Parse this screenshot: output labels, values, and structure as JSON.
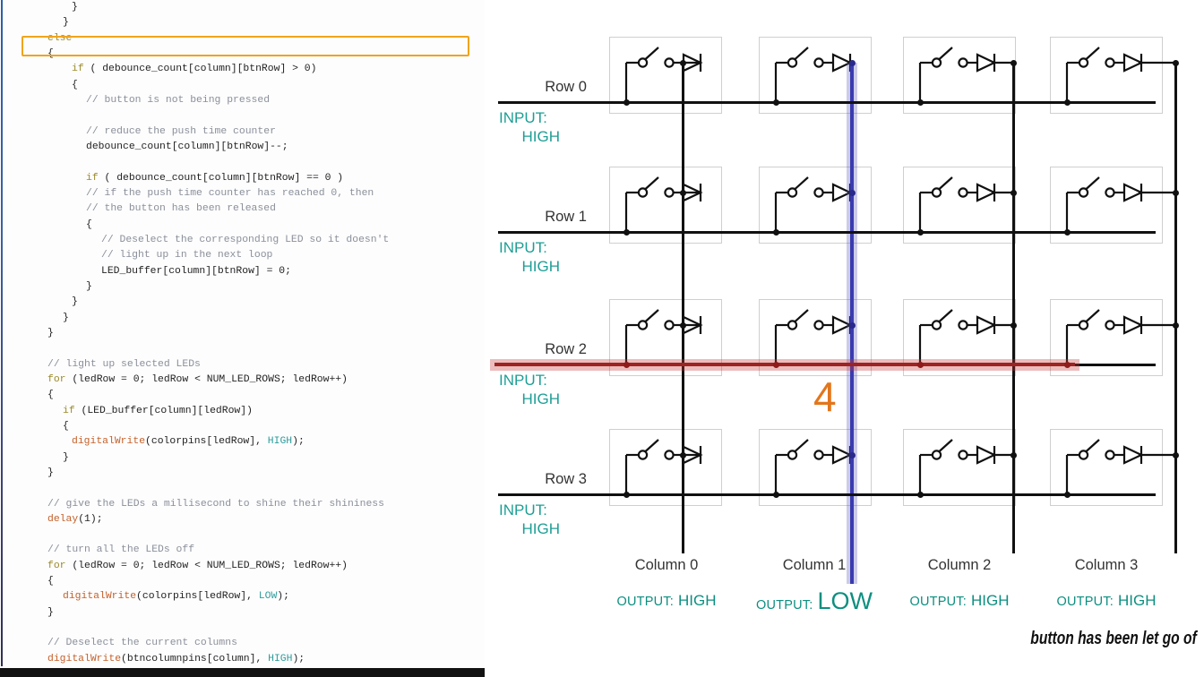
{
  "code_panel": {
    "highlighted_line": "else",
    "lines": [
      {
        "indent": "ind3",
        "text": "}"
      },
      {
        "indent": "ind2",
        "text": "}"
      },
      {
        "indent": "ind1",
        "text": "else"
      },
      {
        "indent": "ind1",
        "text": "{"
      },
      {
        "indent": "ind3",
        "text": "if ( debounce_count[column][btnRow] > 0)"
      },
      {
        "indent": "ind3",
        "text": "{"
      },
      {
        "indent": "ind4",
        "text": "// button is not being pressed"
      },
      {
        "indent": "ind4",
        "text": ""
      },
      {
        "indent": "ind4",
        "text": "// reduce the push time counter"
      },
      {
        "indent": "ind4",
        "text": "debounce_count[column][btnRow]--;"
      },
      {
        "indent": "ind4",
        "text": ""
      },
      {
        "indent": "ind4",
        "text": "if ( debounce_count[column][btnRow] == 0 )"
      },
      {
        "indent": "ind4",
        "text": "// if the push time counter has reached 0, then"
      },
      {
        "indent": "ind4",
        "text": "// the button has been released"
      },
      {
        "indent": "ind4",
        "text": "{"
      },
      {
        "indent": "ind5",
        "text": "// Deselect the corresponding LED so it doesn't"
      },
      {
        "indent": "ind5",
        "text": "// light up in the next loop"
      },
      {
        "indent": "ind5",
        "text": "LED_buffer[column][btnRow] = 0;"
      },
      {
        "indent": "ind4",
        "text": "}"
      },
      {
        "indent": "ind3",
        "text": "}"
      },
      {
        "indent": "ind2",
        "text": "}"
      },
      {
        "indent": "ind1",
        "text": "}"
      },
      {
        "indent": "ind1",
        "text": ""
      },
      {
        "indent": "ind1",
        "text": "// light up selected LEDs"
      },
      {
        "indent": "ind1",
        "text": "for (ledRow = 0; ledRow < NUM_LED_ROWS; ledRow++)"
      },
      {
        "indent": "ind1",
        "text": "{"
      },
      {
        "indent": "ind2",
        "text": "if (LED_buffer[column][ledRow])"
      },
      {
        "indent": "ind2",
        "text": "{"
      },
      {
        "indent": "ind3",
        "text": "digitalWrite(colorpins[ledRow], HIGH);"
      },
      {
        "indent": "ind2",
        "text": "}"
      },
      {
        "indent": "ind1",
        "text": "}"
      },
      {
        "indent": "ind1",
        "text": ""
      },
      {
        "indent": "ind1",
        "text": "// give the LEDs a millisecond to shine their shininess"
      },
      {
        "indent": "ind1",
        "text": "delay(1);"
      },
      {
        "indent": "ind1",
        "text": ""
      },
      {
        "indent": "ind1",
        "text": "// turn all the LEDs off"
      },
      {
        "indent": "ind1",
        "text": "for (ledRow = 0; ledRow < NUM_LED_ROWS; ledRow++)"
      },
      {
        "indent": "ind1",
        "text": "{"
      },
      {
        "indent": "ind2",
        "text": "digitalWrite(colorpins[ledRow], LOW);"
      },
      {
        "indent": "ind1",
        "text": "}"
      },
      {
        "indent": "ind1",
        "text": ""
      },
      {
        "indent": "ind1",
        "text": "// Deselect the current columns"
      },
      {
        "indent": "ind1",
        "text": "digitalWrite(btncolumnpins[column], HIGH);"
      }
    ]
  },
  "diagram": {
    "rows": [
      {
        "label": "Row 0",
        "input_prefix": "INPUT:",
        "input_value": "HIGH"
      },
      {
        "label": "Row 1",
        "input_prefix": "INPUT:",
        "input_value": "HIGH"
      },
      {
        "label": "Row 2",
        "input_prefix": "INPUT:",
        "input_value": "HIGH"
      },
      {
        "label": "Row 3",
        "input_prefix": "INPUT:",
        "input_value": "HIGH"
      }
    ],
    "columns": [
      {
        "label": "Column 0",
        "output_prefix": "OUTPUT:",
        "output_value": "HIGH",
        "active": false
      },
      {
        "label": "Column 1",
        "output_prefix": "OUTPUT:",
        "output_value": "LOW",
        "active": true
      },
      {
        "label": "Column 2",
        "output_prefix": "OUTPUT:",
        "output_value": "HIGH",
        "active": false
      },
      {
        "label": "Column 3",
        "output_prefix": "OUTPUT:",
        "output_value": "HIGH",
        "active": false
      }
    ],
    "step_marker": "4",
    "caption": "button has been let go of",
    "highlight_row_index": 2,
    "highlight_column_index": 1,
    "colors": {
      "row_highlight": "#9e2323",
      "column_highlight": "#3b3bb0",
      "input_label": "#1f9e95",
      "output_label": "#0d8f80",
      "marker": "#e3761b",
      "code_highlight_border": "#f0a41e"
    }
  }
}
